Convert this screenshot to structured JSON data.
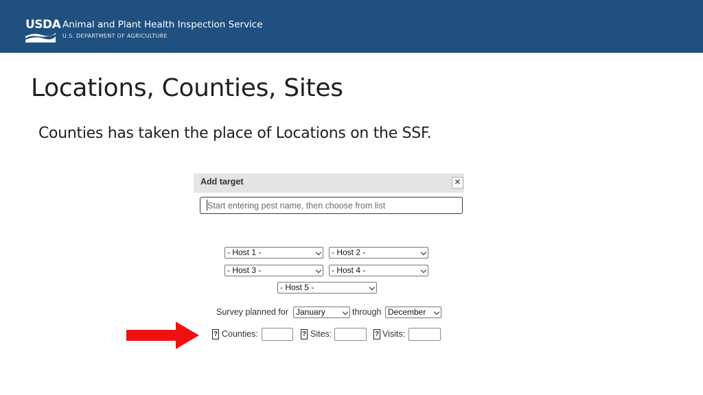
{
  "header": {
    "logo_text": "USDA",
    "agency": "Animal and Plant Health Inspection Service",
    "department": "U.S. DEPARTMENT OF AGRICULTURE",
    "background_color": "#205080"
  },
  "slide": {
    "title": "Locations, Counties, Sites",
    "subtitle": "Counties has taken the place of Locations on the SSF."
  },
  "form": {
    "dialog_title": "Add target",
    "close_icon": "close-icon",
    "pest_placeholder": "Start entering pest name, then choose from list",
    "hosts": [
      "- Host 1 -",
      "- Host 2 -",
      "- Host 3 -",
      "- Host 4 -",
      "- Host 5 -"
    ],
    "survey_planned_label": "Survey planned for",
    "start_month": "January",
    "through_label": "through",
    "end_month": "December",
    "help_symbol": "?",
    "counties_label": "Counties:",
    "sites_label": "Sites:",
    "visits_label": "Visits:"
  },
  "annotation": {
    "arrow_icon": "red-arrow-icon",
    "arrow_color": "#ee1111"
  }
}
